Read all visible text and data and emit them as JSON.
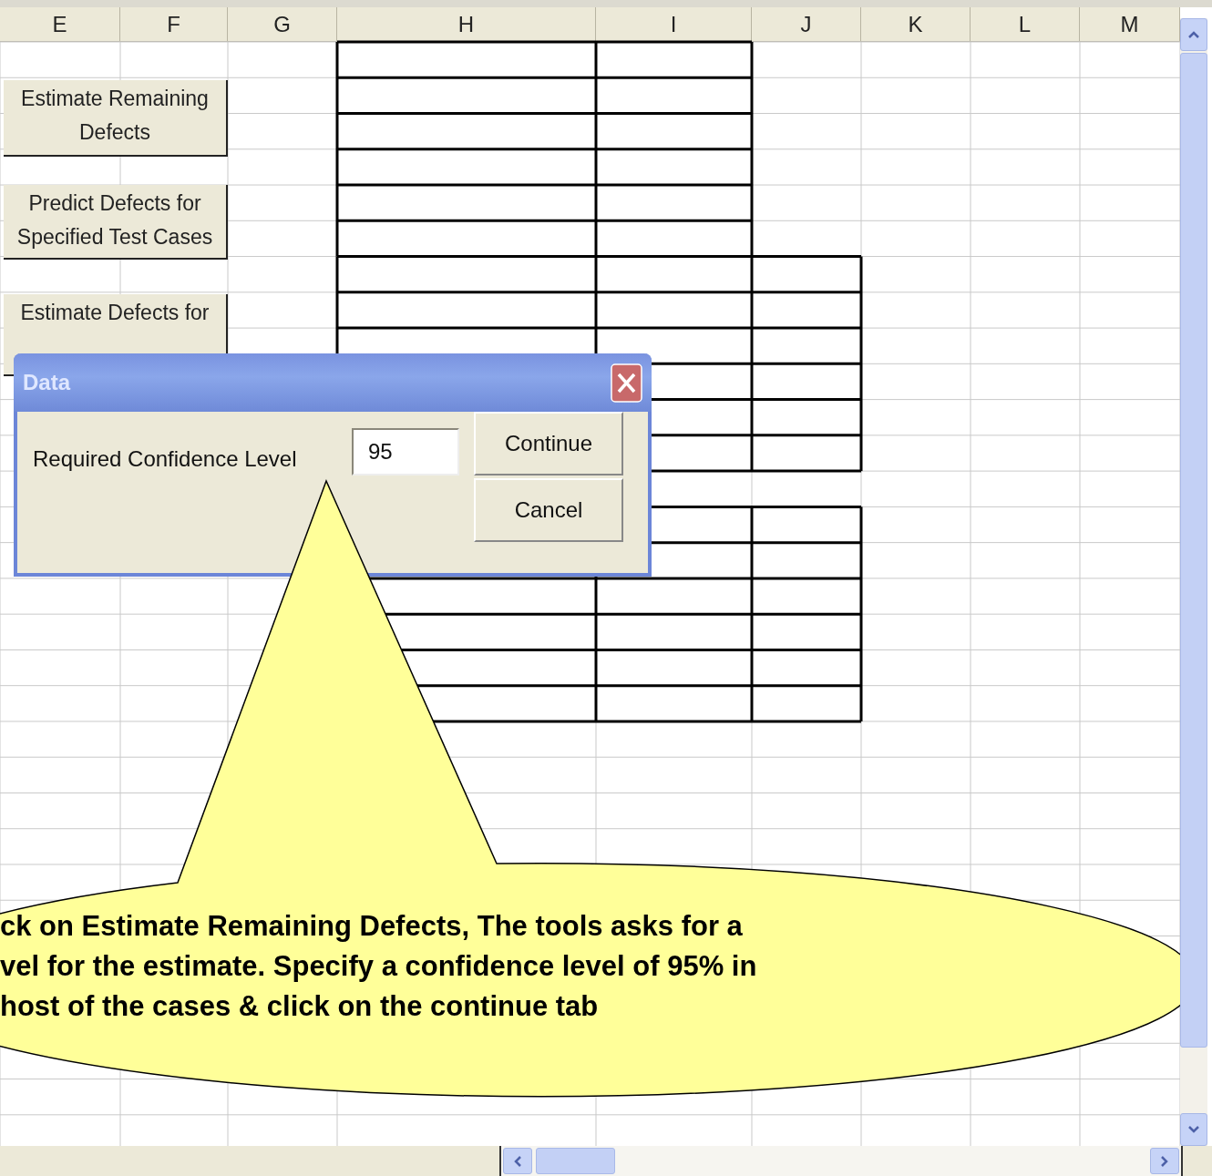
{
  "columns": [
    "E",
    "F",
    "G",
    "H",
    "I",
    "J",
    "K",
    "L",
    "M"
  ],
  "sheet_buttons": [
    "Estimate Remaining Defects",
    "Predict Defects for Specified Test Cases",
    "Estimate Defects for"
  ],
  "dialog": {
    "title": "Data",
    "label": "Required Confidence Level",
    "value": "95",
    "buttons": [
      "Continue",
      "Cancel"
    ]
  },
  "callout": {
    "lines": [
      "ck on Estimate Remaining Defects, The tools asks for a",
      "vel for the estimate. Specify a confidence level of 95% in",
      "host of the cases & click on the continue tab"
    ]
  }
}
